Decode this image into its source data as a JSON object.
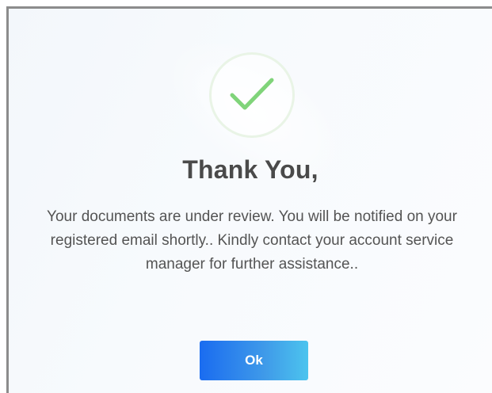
{
  "dialog": {
    "title": "Thank You,",
    "message": "Your documents are under review. You will be notified on your registered email shortly.. Kindly contact your account service manager for further assistance..",
    "ok_label": "Ok",
    "icon": "check-icon"
  },
  "colors": {
    "check": "#80d47a",
    "check_ring": "#e9f4e6",
    "button_start": "#1a6cf0",
    "button_end": "#4cc4ee",
    "title": "#4a4a4a",
    "text": "#545454"
  }
}
